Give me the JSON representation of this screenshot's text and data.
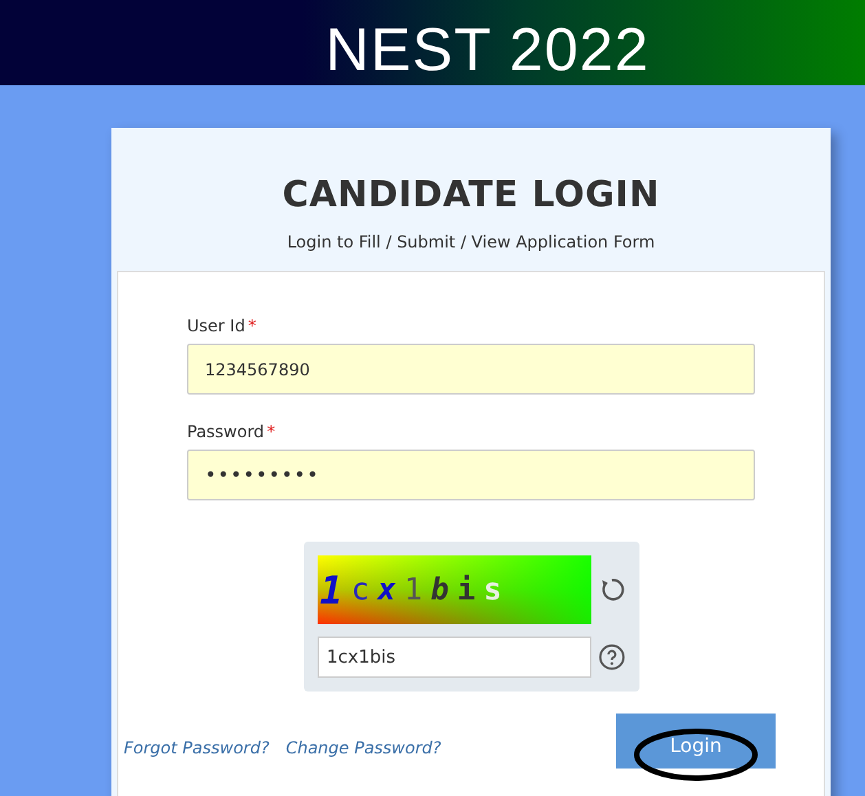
{
  "banner": {
    "title": "NEST 2022"
  },
  "login_card": {
    "title": "CANDIDATE LOGIN",
    "subtitle": "Login to Fill / Submit / View Application Form"
  },
  "fields": [
    {
      "label": "User Id",
      "required_mark": "*",
      "value": "1234567890"
    },
    {
      "label": "Password",
      "required_mark": "*",
      "value": "•••••••••"
    }
  ],
  "captcha": {
    "characters": [
      {
        "char": "1",
        "color": "#1010c8",
        "bold": true,
        "italic": true
      },
      {
        "char": "c",
        "color": "#2a2ab8",
        "bold": false,
        "italic": false
      },
      {
        "char": "x",
        "color": "#1010c8",
        "bold": true,
        "italic": true
      },
      {
        "char": "1",
        "color": "#555555",
        "bold": false,
        "italic": false
      },
      {
        "char": "b",
        "color": "#333333",
        "bold": true,
        "italic": true
      },
      {
        "char": "i",
        "color": "#333333",
        "bold": true,
        "italic": false
      },
      {
        "char": "s",
        "color": "#e8f0e0",
        "bold": true,
        "italic": false
      }
    ],
    "answer": "1cx1bis"
  },
  "links": [
    "Forgot Password?",
    "Change Password?"
  ],
  "login_button": {
    "label": "Login",
    "circled": true
  }
}
